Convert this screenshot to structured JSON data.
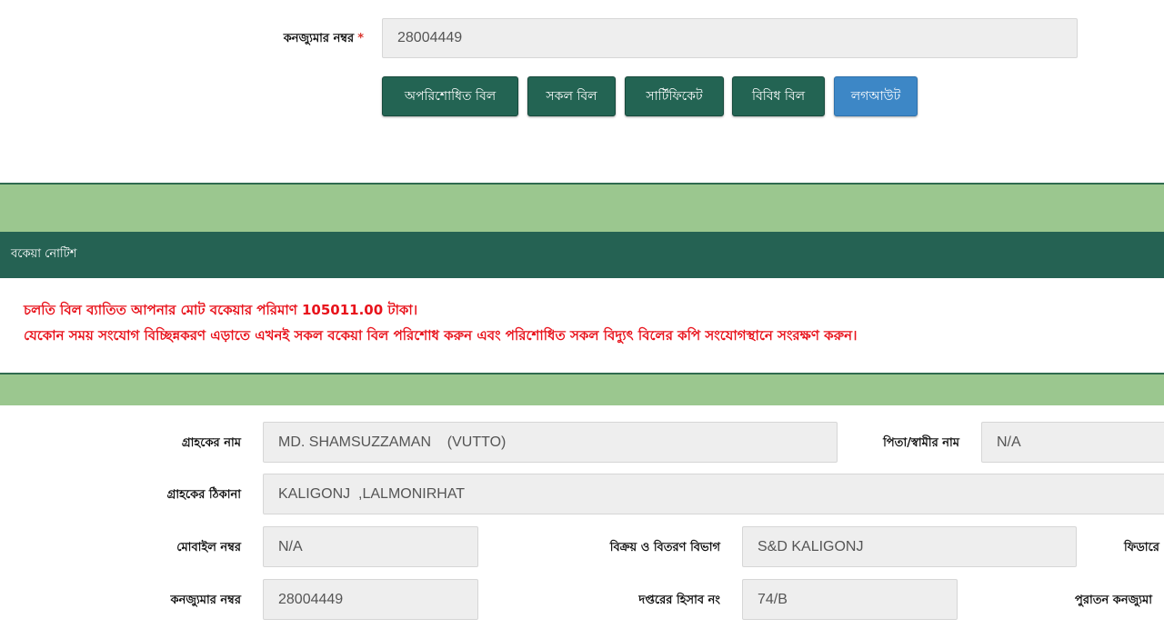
{
  "top": {
    "consumer_label": "কনজ্যুমার নম্বর",
    "required_mark": "*",
    "consumer_value": "28004449",
    "buttons": {
      "unpaid": "অপরিশোধিত বিল",
      "all": "সকল বিল",
      "certificate": "সার্টিফিকেট",
      "misc": "বিবিধ বিল",
      "logout": "লগআউট"
    }
  },
  "notice": {
    "title": "বকেয়া নোটিশ",
    "line1": "চলতি বিল ব্যাতিত আপনার মোট বকেয়ার পরিমাণ 105011.00 টাকা।",
    "line2": "যেকোন সময় সংযোগ বিচ্ছিন্নকরণ এড়াতে এখনই সকল বকেয়া বিল পরিশোধ করুন এবং পরিশোধিত সকল বিদ্যুৎ বিলের কপি সংযোগস্থানে সংরক্ষণ করুন।"
  },
  "details": {
    "customer_name_label": "গ্রাহকের নাম",
    "customer_name": "MD. SHAMSUZZAMAN    (VUTTO)",
    "father_label": "পিতা/স্বামীর নাম",
    "father_value": "N/A",
    "address_label": "গ্রাহকের ঠিকানা",
    "address_value": "KALIGONJ  ,LALMONIRHAT",
    "mobile_label": "মোবাইল নম্বর",
    "mobile_value": "N/A",
    "division_label": "বিক্রয় ও বিতরণ বিভাগ",
    "division_value": "S&D KALIGONJ",
    "feeder_label": "ফিডারে",
    "consumer_label": "কনজ্যুমার নম্বর",
    "consumer_value": "28004449",
    "account_label": "দপ্তরের হিসাব নং",
    "account_value": "74/B",
    "old_consumer_label": "পুরাতন কনজ্যুমা"
  },
  "colors": {
    "dark_green": "#256253",
    "light_green": "#9bc78f",
    "logout_blue": "#3d87c6",
    "notice_red": "#e8121b"
  }
}
